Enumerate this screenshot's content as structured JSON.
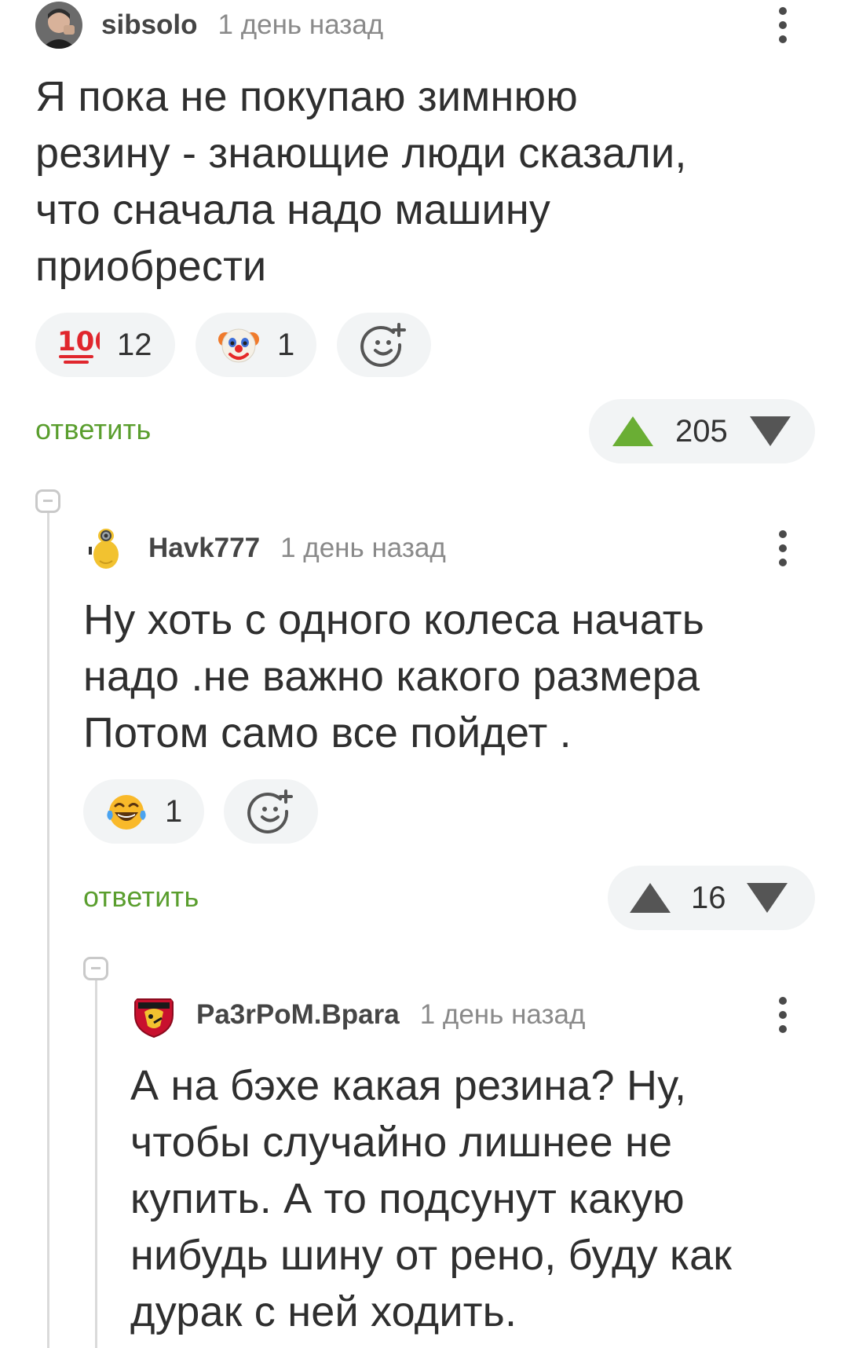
{
  "comments": [
    {
      "username": "sibsolo",
      "time": "1 день назад",
      "text": "Я пока не покупаю зимнюю\nрезину - знающие люди сказали,\nчто сначала надо машину\nприобрести",
      "reactions": [
        {
          "emoji": "hundred-points",
          "count": "12"
        },
        {
          "emoji": "clown-face",
          "count": "1"
        }
      ],
      "reply_label": "ответить",
      "score": "205",
      "upvoted": true
    },
    {
      "username": "Havk777",
      "time": "1 день назад",
      "text": "Ну хоть с одного колеса начать\nнадо .не важно какого размера\nПотом само все пойдет .",
      "reactions": [
        {
          "emoji": "tears-of-joy",
          "count": "1"
        }
      ],
      "reply_label": "ответить",
      "score": "16",
      "upvoted": false
    },
    {
      "username": "Pa3rPoM.Bpara",
      "time": "1 день назад",
      "text": "А на бэхе какая резина? Ну,\nчтобы случайно лишнее не\nкупить. А то подсунут какую\nнибудь шину от рено, буду как\nдурак с ней ходить."
    }
  ],
  "colors": {
    "accent_green": "#5a9e2e",
    "upvote_active": "#6aae34",
    "vote_inactive": "#555555",
    "pill_bg": "#f2f4f5"
  }
}
